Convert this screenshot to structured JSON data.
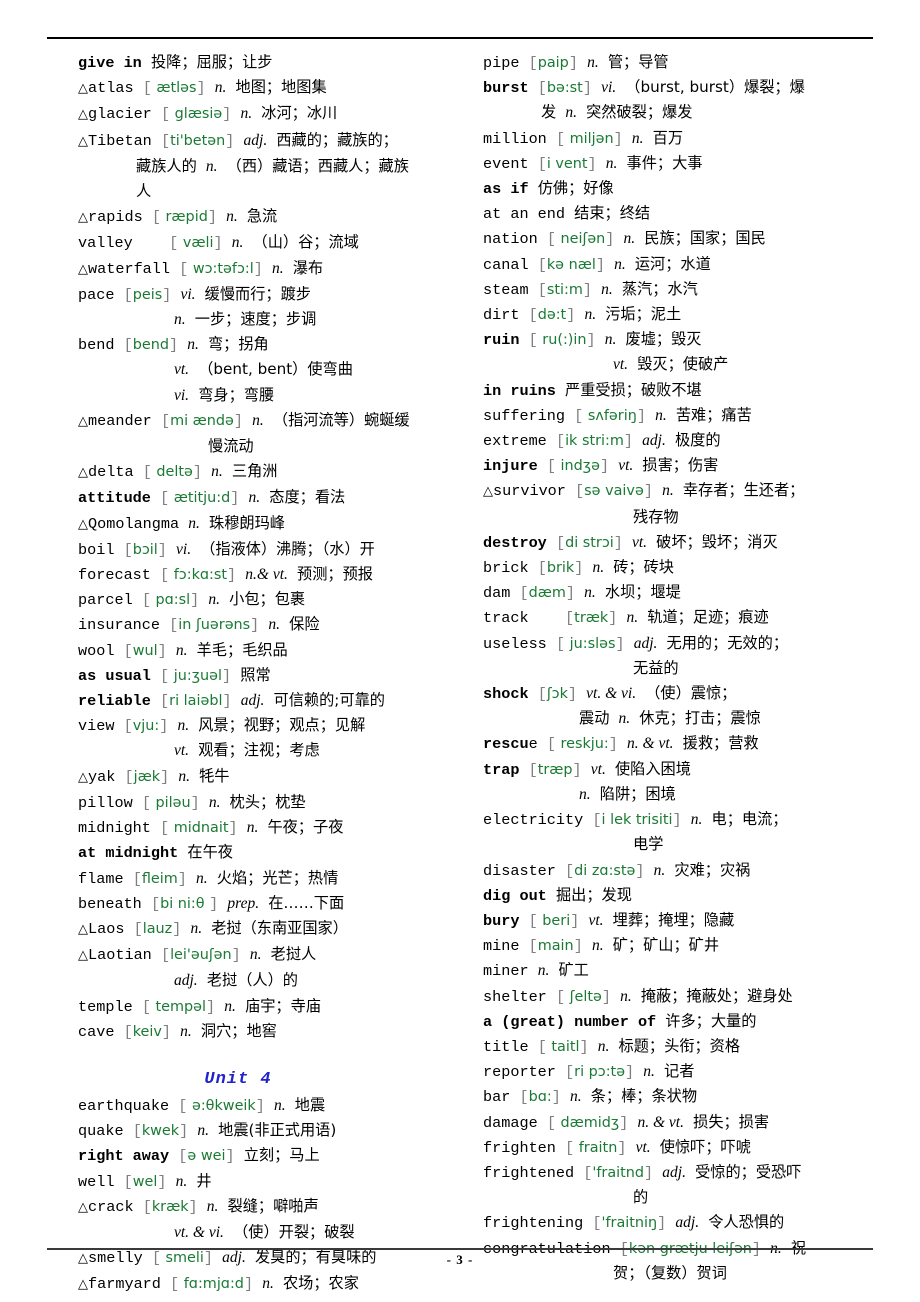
{
  "page": {
    "page_number_label": "- 3 -",
    "unit_heading": "Unit 4",
    "accent_colors": {
      "phonetic_green": "#1a7a34",
      "unit_blue": "#2222cc",
      "bracket_grey": "#7f7f7f",
      "text_black": "#000000"
    }
  },
  "columns": {
    "left": [
      {
        "marker": "",
        "word": "give in",
        "bold": true,
        "phonetic": "",
        "pos": "",
        "meaning": "投降；屈服；让步",
        "cont": []
      },
      {
        "marker": "△",
        "word": "atlas",
        "bold": false,
        "phonetic": "  ætləs",
        "pos": "n.",
        "meaning": "地图；地图集",
        "cont": []
      },
      {
        "marker": "△",
        "word": "glacier",
        "bold": false,
        "phonetic": "  glæsiə",
        "pos": "n.",
        "meaning": "冰河；冰川",
        "cont": []
      },
      {
        "marker": "△",
        "word": "Tibetan",
        "bold": false,
        "phonetic": "ti'betən",
        "pos": "adj.",
        "meaning": "西藏的；藏族的；",
        "cont": [
          {
            "indent": 1,
            "pos": "n.",
            "text_before_pos": "藏族人的",
            "meaning": "（西）藏语；西藏人；藏族"
          },
          {
            "indent": 1,
            "pos": "",
            "text_before_pos": "",
            "meaning": "人"
          }
        ]
      },
      {
        "marker": "△",
        "word": "rapids",
        "bold": false,
        "phonetic": "  ræpid",
        "pos": "n.",
        "meaning": "急流",
        "cont": []
      },
      {
        "marker": "",
        "word": "valley",
        "bold": false,
        "spacing": true,
        "phonetic": "  væli",
        "pos": "n.",
        "meaning": "（山）谷；流域",
        "cont": []
      },
      {
        "marker": "△",
        "word": "waterfall",
        "bold": false,
        "phonetic": "  wɔ:təfɔ:l",
        "pos": "n.",
        "meaning": "瀑布",
        "cont": []
      },
      {
        "marker": "",
        "word": "pace",
        "bold": false,
        "phonetic": "peis",
        "pos": "vi.",
        "meaning": "缓慢而行；踱步",
        "cont": [
          {
            "indent": 2,
            "pos": "n.",
            "meaning": "一步；速度；步调"
          }
        ]
      },
      {
        "marker": "",
        "word": "bend",
        "bold": false,
        "phonetic": "bend",
        "pos": "n.",
        "meaning": "弯；拐角",
        "cont": [
          {
            "indent": 2,
            "pos": "vt.",
            "meaning": "（bent, bent）使弯曲"
          },
          {
            "indent": 2,
            "pos": "vi.",
            "meaning": "弯身；弯腰"
          }
        ]
      },
      {
        "marker": "△",
        "word": "meander",
        "bold": false,
        "phonetic": "mi  ændə",
        "pos": "n.",
        "meaning": "（指河流等）蜿蜒缓",
        "cont": [
          {
            "indent": 3,
            "pos": "",
            "meaning": "慢流动"
          }
        ]
      },
      {
        "marker": "△",
        "word": "delta",
        "bold": false,
        "phonetic": "  deltə",
        "pos": "n.",
        "meaning": "三角洲",
        "cont": []
      },
      {
        "marker": "",
        "word": "attitude",
        "bold": true,
        "phonetic": "  ætitju:d",
        "pos": "n.",
        "meaning": "态度；看法",
        "cont": []
      },
      {
        "marker": "△",
        "word": "Qomolangma",
        "bold": false,
        "phonetic": "",
        "pos": "n.",
        "meaning": "珠穆朗玛峰",
        "cont": []
      },
      {
        "marker": "",
        "word": "boil",
        "bold": false,
        "phonetic": "bɔil",
        "pos": "vi.",
        "meaning": "（指液体）沸腾；（水）开",
        "cont": []
      },
      {
        "marker": "",
        "word": "forecast",
        "bold": false,
        "phonetic": "  fɔ:kɑ:st",
        "pos": "n.& vt.",
        "meaning": "预测；预报",
        "cont": []
      },
      {
        "marker": "",
        "word": "parcel",
        "bold": false,
        "phonetic": "  pɑ:sl",
        "pos": "n.",
        "meaning": "小包；包裹",
        "cont": []
      },
      {
        "marker": "",
        "word": "insurance",
        "bold": false,
        "phonetic": "in  ʃuərəns",
        "pos": "n.",
        "meaning": "保险",
        "cont": []
      },
      {
        "marker": "",
        "word": "wool",
        "bold": false,
        "phonetic": "wul",
        "pos": "n.",
        "meaning": "羊毛；毛织品",
        "cont": []
      },
      {
        "marker": "",
        "word": "as usual",
        "bold": true,
        "phonetic": "  ju:ʒuəl",
        "pos": "",
        "meaning": "照常",
        "cont": []
      },
      {
        "marker": "",
        "word": "reliable",
        "bold": true,
        "phonetic": "ri  laiəbl",
        "pos": "adj.",
        "meaning": "可信赖的;可靠的",
        "cont": []
      },
      {
        "marker": "",
        "word": "view",
        "bold": false,
        "phonetic": "vju:",
        "pos": "n.",
        "meaning": "风景；视野；观点；见解",
        "cont": [
          {
            "indent": 2,
            "pos": "vt.",
            "meaning": "观看；注视；考虑"
          }
        ]
      },
      {
        "marker": "△",
        "word": "yak",
        "bold": false,
        "phonetic": "jæk",
        "pos": "n.",
        "meaning": "牦牛",
        "cont": []
      },
      {
        "marker": "",
        "word": "pillow",
        "bold": false,
        "phonetic": "  piləu",
        "pos": "n.",
        "meaning": "枕头；枕垫",
        "cont": []
      },
      {
        "marker": "",
        "word": "midnight",
        "bold": false,
        "phonetic": "  midnait",
        "pos": "n.",
        "meaning": "午夜；子夜",
        "cont": []
      },
      {
        "marker": "",
        "word": "at midnight",
        "bold": true,
        "phonetic": "",
        "pos": "",
        "meaning": "在午夜",
        "cont": []
      },
      {
        "marker": "",
        "word": "flame",
        "bold": false,
        "phonetic": "fleim",
        "pos": "n.",
        "meaning": "火焰；光芒；热情",
        "cont": []
      },
      {
        "marker": "",
        "word": "beneath",
        "bold": false,
        "phonetic": "bi  ni:θ ",
        "pos": "prep.",
        "meaning": "在……下面",
        "cont": []
      },
      {
        "marker": "△",
        "word": "Laos",
        "bold": false,
        "phonetic": "lauz",
        "pos": "n.",
        "meaning": "老挝（东南亚国家）",
        "cont": []
      },
      {
        "marker": "△",
        "word": "Laotian",
        "bold": false,
        "phonetic": "lei'əuʃən",
        "pos": "n.",
        "meaning": "老挝人",
        "cont": [
          {
            "indent": 2,
            "pos": "adj.",
            "meaning": "老挝（人）的"
          }
        ]
      },
      {
        "marker": "",
        "word": "temple",
        "bold": false,
        "phonetic": "  tempəl",
        "pos": "n.",
        "meaning": "庙宇；寺庙",
        "cont": []
      },
      {
        "marker": "",
        "word": "cave",
        "bold": false,
        "phonetic": "keiv",
        "pos": "n.",
        "meaning": "洞穴；地窖",
        "cont": []
      }
    ],
    "left_after_unit": [
      {
        "marker": "",
        "word": "earthquake",
        "bold": false,
        "phonetic": "  ə:θkweik",
        "pos": "n.",
        "meaning": "地震",
        "cont": []
      },
      {
        "marker": "",
        "word": "quake",
        "bold": false,
        "phonetic": "kwek",
        "pos": "n.",
        "meaning": "地震(非正式用语)",
        "cont": []
      },
      {
        "marker": "",
        "word": "right away",
        "bold": true,
        "phonetic": "ə  wei",
        "pos": "",
        "meaning": "立刻；马上",
        "cont": []
      },
      {
        "marker": "",
        "word": "well",
        "bold": false,
        "phonetic": "wel",
        "pos": "n.",
        "meaning": "井",
        "cont": []
      },
      {
        "marker": "△",
        "word": "crack",
        "bold": false,
        "phonetic": "kræk",
        "pos": "n.",
        "meaning": "裂缝；噼啪声",
        "cont": [
          {
            "indent": 2,
            "pos": "vt. & vi.",
            "meaning": "（使）开裂；破裂"
          }
        ]
      },
      {
        "marker": "△",
        "word": "smelly",
        "bold": false,
        "phonetic": "  smeli",
        "pos": "adj.",
        "meaning": "发臭的；有臭味的",
        "cont": []
      },
      {
        "marker": "△",
        "word": "farmyard",
        "bold": false,
        "phonetic": "  fɑ:mjɑ:d",
        "pos": "n.",
        "meaning": "农场；农家",
        "cont": []
      }
    ],
    "right": [
      {
        "marker": "",
        "word": "pipe",
        "bold": false,
        "phonetic": "paip",
        "pos": "n.",
        "meaning": "管；导管",
        "cont": []
      },
      {
        "marker": "",
        "word": "burst",
        "bold": true,
        "phonetic": "bə:st",
        "pos": "vi.",
        "meaning": "（burst, burst）爆裂；爆",
        "cont": [
          {
            "indent": 1,
            "pos": "n.",
            "text_before_pos": "发",
            "meaning": "突然破裂；爆发"
          }
        ]
      },
      {
        "marker": "",
        "word": "million",
        "bold": false,
        "phonetic": "  miljən",
        "pos": "n.",
        "meaning": "百万",
        "cont": []
      },
      {
        "marker": "",
        "word": "event",
        "bold": false,
        "phonetic": "i  vent",
        "pos": "n.",
        "meaning": "事件；大事",
        "cont": []
      },
      {
        "marker": "",
        "word": "as if",
        "bold": true,
        "phonetic": "",
        "pos": "",
        "meaning": "仿佛；好像",
        "cont": []
      },
      {
        "marker": "",
        "word": "at an end",
        "bold": false,
        "phonetic": "",
        "pos": "",
        "meaning": "结束；终结",
        "cont": []
      },
      {
        "marker": "",
        "word": "nation",
        "bold": false,
        "phonetic": "  neiʃən",
        "pos": "n.",
        "meaning": "民族；国家；国民",
        "cont": []
      },
      {
        "marker": "",
        "word": "canal",
        "bold": false,
        "phonetic": "kə  næl",
        "pos": "n.",
        "meaning": "运河；水道",
        "cont": []
      },
      {
        "marker": "",
        "word": "steam",
        "bold": false,
        "phonetic": "sti:m",
        "pos": "n.",
        "meaning": "蒸汽；水汽",
        "cont": []
      },
      {
        "marker": "",
        "word": "dirt",
        "bold": false,
        "phonetic": "də:t",
        "pos": "n.",
        "meaning": "污垢；泥土",
        "cont": []
      },
      {
        "marker": "",
        "word": "ruin",
        "bold": true,
        "phonetic": "  ru(:)in",
        "pos": "n.",
        "meaning": "废墟；毁灭",
        "cont": [
          {
            "indent": 3,
            "pos": "vt.",
            "meaning": "毁灭；使破产"
          }
        ]
      },
      {
        "marker": "",
        "word": "in ruins",
        "bold": true,
        "phonetic": "",
        "pos": "",
        "meaning": "严重受损；破败不堪",
        "cont": []
      },
      {
        "marker": "",
        "word": "suffering",
        "bold": false,
        "phonetic": "  sʌfəriŋ",
        "pos": "n.",
        "meaning": "苦难；痛苦",
        "cont": []
      },
      {
        "marker": "",
        "word": "extreme",
        "bold": false,
        "phonetic": "ik  stri:m",
        "pos": "adj.",
        "meaning": "极度的",
        "cont": []
      },
      {
        "marker": "",
        "word": "injure",
        "bold": true,
        "phonetic": "  indʒə",
        "pos": "vt.",
        "meaning": "损害；伤害",
        "cont": []
      },
      {
        "marker": "△",
        "word": "survivor",
        "bold": false,
        "phonetic": "sə  vaivə",
        "pos": "n.",
        "meaning": "幸存者；生还者；",
        "cont": [
          {
            "indent": 4,
            "pos": "",
            "meaning": "残存物"
          }
        ]
      },
      {
        "marker": "",
        "word": "destroy",
        "bold": true,
        "phonetic": "di  strɔi",
        "pos": "vt.",
        "meaning": "破坏；毁坏；消灭",
        "cont": []
      },
      {
        "marker": "",
        "word": "brick",
        "bold": false,
        "phonetic": "brik",
        "pos": "n.",
        "meaning": "砖；砖块",
        "cont": []
      },
      {
        "marker": "",
        "word": "dam",
        "bold": false,
        "phonetic": "dæm",
        "pos": "n.",
        "meaning": "水坝；堰堤",
        "cont": []
      },
      {
        "marker": "",
        "word": "track",
        "bold": false,
        "spacing": true,
        "phonetic": "træk",
        "pos": "n.",
        "meaning": "轨道；足迹；痕迹",
        "cont": []
      },
      {
        "marker": "",
        "word": "useless",
        "bold": false,
        "phonetic": "  ju:sləs",
        "pos": "adj.",
        "meaning": "无用的；无效的；",
        "cont": [
          {
            "indent": 4,
            "pos": "",
            "meaning": "无益的"
          }
        ]
      },
      {
        "marker": "",
        "word": "shock",
        "bold": true,
        "phonetic": "ʃɔk",
        "pos": "vt. & vi.",
        "meaning": "（使）震惊；",
        "cont": [
          {
            "indent": 2,
            "pos": "n.",
            "text_before_pos": "震动",
            "meaning": "休克；打击；震惊"
          }
        ]
      },
      {
        "marker": "",
        "word": "rescue",
        "bold": true,
        "bold_partial": "rescu",
        "phonetic": "  reskju:",
        "pos": "n. & vt.",
        "meaning": "援救；营救",
        "cont": []
      },
      {
        "marker": "",
        "word": "trap",
        "bold": true,
        "phonetic": "træp",
        "pos": "vt.",
        "meaning": "使陷入困境",
        "cont": [
          {
            "indent": 2,
            "pos": "n.",
            "meaning": "陷阱；困境"
          }
        ]
      },
      {
        "marker": "",
        "word": "electricity",
        "bold": false,
        "phonetic": "i  lek  trisiti",
        "pos": "n.",
        "meaning": "电；电流；",
        "cont": [
          {
            "indent": 4,
            "pos": "",
            "meaning": "电学"
          }
        ]
      },
      {
        "marker": "",
        "word": "disaster",
        "bold": false,
        "phonetic": "di  zɑ:stə",
        "pos": "n.",
        "meaning": "灾难；灾祸",
        "cont": []
      },
      {
        "marker": "",
        "word": "dig out",
        "bold": true,
        "phonetic": "",
        "pos": "",
        "meaning": "掘出；发现",
        "cont": []
      },
      {
        "marker": "",
        "word": "bury",
        "bold": true,
        "phonetic": "  beri",
        "pos": "vt.",
        "meaning": "埋葬；掩埋；隐藏",
        "cont": []
      },
      {
        "marker": "",
        "word": "mine",
        "bold": false,
        "phonetic": "main",
        "pos": "n.",
        "meaning": "矿；矿山；矿井",
        "cont": []
      },
      {
        "marker": "",
        "word": "miner",
        "bold": false,
        "phonetic": "",
        "pos": "n.",
        "meaning": "矿工",
        "cont": []
      },
      {
        "marker": "",
        "word": "shelter",
        "bold": false,
        "phonetic": "  ʃeltə",
        "pos": "n.",
        "meaning": "掩蔽；掩蔽处；避身处",
        "cont": []
      },
      {
        "marker": "",
        "word": "a (great) number of",
        "bold": true,
        "phonetic": "",
        "pos": "",
        "meaning": "许多；大量的",
        "cont": []
      },
      {
        "marker": "",
        "word": "title",
        "bold": false,
        "phonetic": "  taitl",
        "pos": "n.",
        "meaning": "标题；头衔；资格",
        "cont": []
      },
      {
        "marker": "",
        "word": "reporter",
        "bold": false,
        "phonetic": "ri  pɔ:tə",
        "pos": "n.",
        "meaning": "记者",
        "cont": []
      },
      {
        "marker": "",
        "word": "bar",
        "bold": false,
        "phonetic": "bɑ:",
        "pos": "n.",
        "meaning": "条；棒；条状物",
        "cont": []
      },
      {
        "marker": "",
        "word": "damage",
        "bold": false,
        "phonetic": "  dæmidʒ",
        "pos": "n. & vt.",
        "meaning": "损失；损害",
        "cont": []
      },
      {
        "marker": "",
        "word": "frighten",
        "bold": false,
        "phonetic": "  fraitn",
        "pos": "vt.",
        "meaning": "使惊吓；吓唬",
        "cont": []
      },
      {
        "marker": "",
        "word": "frightened",
        "bold": false,
        "phonetic": "'fraitnd",
        "pos": "adj.",
        "meaning": "受惊的；受恐吓",
        "cont": [
          {
            "indent": 4,
            "pos": "",
            "meaning": "的"
          }
        ]
      },
      {
        "marker": "",
        "word": "frightening",
        "bold": false,
        "phonetic": "'fraitniŋ",
        "pos": "adj.",
        "meaning": "令人恐惧的",
        "cont": []
      },
      {
        "marker": "",
        "word": "congratulation",
        "bold": false,
        "phonetic": "kən  grætju  leiʃən",
        "pos": "n.",
        "meaning": "祝",
        "cont": [
          {
            "indent": 3,
            "pos": "",
            "meaning": "贺；（复数）贺词"
          }
        ]
      }
    ]
  }
}
